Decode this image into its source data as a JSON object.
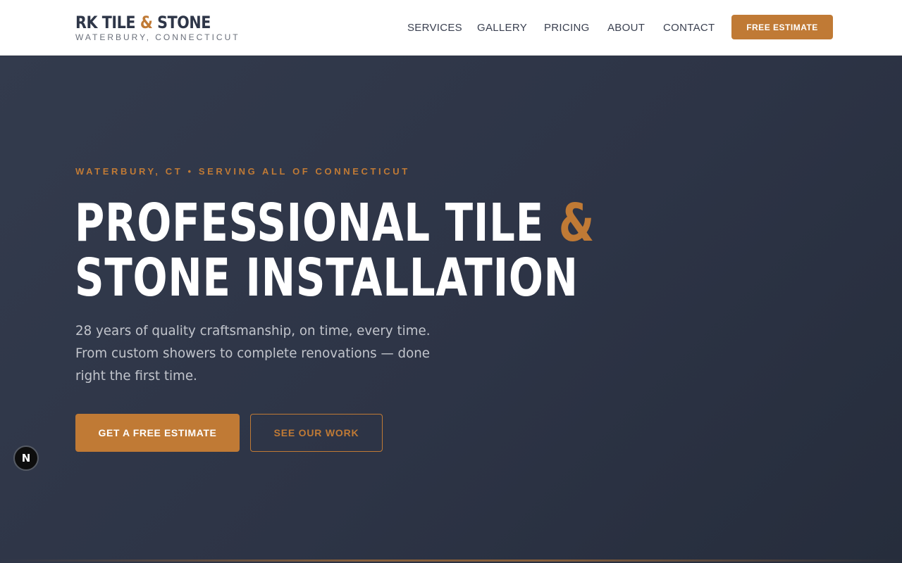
{
  "brand": {
    "name_part1": "RK TILE ",
    "name_amp": "&",
    "name_part2": " STONE",
    "tagline": "WATERBURY, CONNECTICUT"
  },
  "nav": {
    "items": [
      {
        "label": "SERVICES"
      },
      {
        "label": "GALLERY"
      },
      {
        "label": "PRICING"
      },
      {
        "label": "ABOUT"
      },
      {
        "label": "CONTACT"
      }
    ],
    "cta_label": "FREE ESTIMATE"
  },
  "hero": {
    "eyebrow": "WATERBURY, CT • SERVING ALL OF CONNECTICUT",
    "headline_line1": "PROFESSIONAL TILE ",
    "headline_amp": "&",
    "headline_line2": "STONE INSTALLATION",
    "description": "28 years of quality craftsmanship, on time, every time. From custom showers to complete renovations — done right the first time.",
    "primary_cta": "GET A FREE ESTIMATE",
    "secondary_cta": "SEE OUR WORK"
  },
  "dev_badge": {
    "letter": "N",
    "icon": "nextjs-icon"
  },
  "colors": {
    "accent": "#c07a35",
    "hero_bg": "#2d3446",
    "header_bg": "#ffffff",
    "text_dark": "#2e3648"
  }
}
